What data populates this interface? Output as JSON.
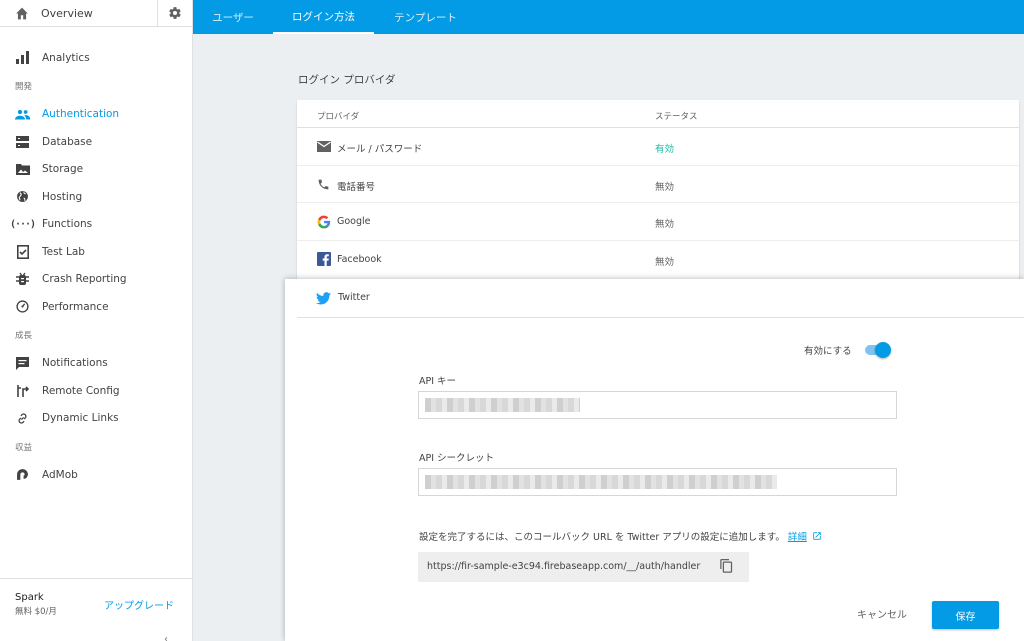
{
  "sidebar": {
    "overview": "Overview",
    "sections": {
      "develop": "開発",
      "grow": "成長",
      "earn": "収益"
    },
    "items": {
      "analytics": "Analytics",
      "authentication": "Authentication",
      "database": "Database",
      "storage": "Storage",
      "hosting": "Hosting",
      "functions": "Functions",
      "testlab": "Test Lab",
      "crash": "Crash Reporting",
      "performance": "Performance",
      "notifications": "Notifications",
      "remoteconfig": "Remote Config",
      "dynamiclinks": "Dynamic Links",
      "admob": "AdMob"
    },
    "plan": {
      "name": "Spark",
      "price": "無料 $0/月",
      "upgrade": "アップグレード"
    },
    "collapse": "‹"
  },
  "tabs": [
    "ユーザー",
    "ログイン方法",
    "テンプレート"
  ],
  "active_tab": "ログイン方法",
  "providers": {
    "title": "ログイン プロバイダ",
    "col_provider": "プロバイダ",
    "col_status": "ステータス",
    "rows": [
      {
        "name": "メール / パスワード",
        "status": "有効",
        "icon": "email-icon"
      },
      {
        "name": "電話番号",
        "status": "無効",
        "icon": "phone-icon"
      },
      {
        "name": "Google",
        "status": "無効",
        "icon": "google-icon"
      },
      {
        "name": "Facebook",
        "status": "無効",
        "icon": "facebook-icon"
      }
    ]
  },
  "twitter": {
    "name": "Twitter",
    "enable_label": "有効にする",
    "enabled": true,
    "api_key_label": "API キー",
    "api_secret_label": "API シークレット",
    "note": "設定を完了するには、このコールバック URL を Twitter アプリの設定に追加します。",
    "details_link": "詳細",
    "callback_url": "https://fir-sample-e3c94.firebaseapp.com/__/auth/handler",
    "cancel": "キャンセル",
    "save": "保存"
  },
  "colors": {
    "accent": "#039be5",
    "enabled_status": "#1db9a0",
    "background": "#eceff1"
  }
}
